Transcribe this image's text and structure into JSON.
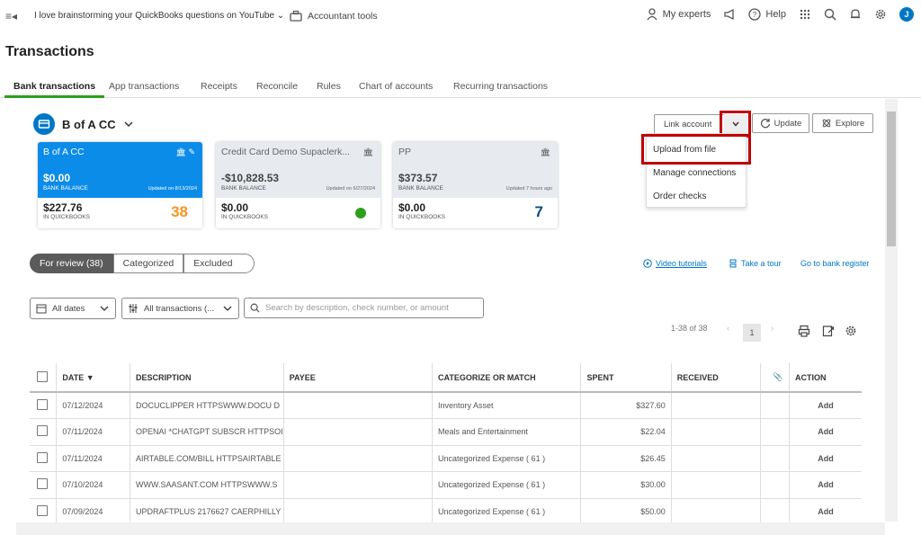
{
  "topbar": {
    "company": "I love brainstorming your QuickBooks questions on YouTube",
    "accountant_tools": "Accountant tools",
    "my_experts": "My experts",
    "help": "Help",
    "avatar_letter": "J"
  },
  "page_title": "Transactions",
  "tabs": [
    {
      "label": "Bank transactions"
    },
    {
      "label": "App transactions"
    },
    {
      "label": "Receipts"
    },
    {
      "label": "Reconcile"
    },
    {
      "label": "Rules"
    },
    {
      "label": "Chart of accounts"
    },
    {
      "label": "Recurring transactions"
    }
  ],
  "account": {
    "name": "B of A CC"
  },
  "cards": [
    {
      "name": "B of A CC",
      "bank_balance": "$0.00",
      "bank_label": "BANK BALANCE",
      "updated": "Updated on 8/13/2024",
      "qb_balance": "$227.76",
      "qb_label": "IN QUICKBOOKS",
      "count": "38"
    },
    {
      "name": "Credit Card Demo Supaclerk...",
      "bank_balance": "-$10,828.53",
      "bank_label": "BANK BALANCE",
      "updated": "Updated on 6/27/2024",
      "qb_balance": "$0.00",
      "qb_label": "IN QUICKBOOKS"
    },
    {
      "name": "PP",
      "bank_balance": "$373.57",
      "bank_label": "BANK BALANCE",
      "updated": "Updated 7 hours ago",
      "qb_balance": "$0.00",
      "qb_label": "IN QUICKBOOKS",
      "count": "7"
    }
  ],
  "actions": {
    "link_account": "Link account",
    "update": "Update",
    "explore": "Explore"
  },
  "dropdown": {
    "items": [
      "Upload from file",
      "Manage connections",
      "Order checks"
    ]
  },
  "review_tabs": [
    "For review (38)",
    "Categorized",
    "Excluded"
  ],
  "links": {
    "video": "Video tutorials",
    "tour": "Take a tour",
    "register": "Go to bank register"
  },
  "filters": {
    "dates": "All dates",
    "transactions": "All transactions (...",
    "search_placeholder": "Search by description, check number, or amount"
  },
  "pagination": {
    "range": "1-38 of 38",
    "page": "1"
  },
  "table": {
    "headers": [
      "DATE ▼",
      "DESCRIPTION",
      "PAYEE",
      "CATEGORIZE OR MATCH",
      "SPENT",
      "RECEIVED",
      "ACTION"
    ],
    "rows": [
      {
        "date": "07/12/2024",
        "description": "DOCUCLIPPER HTTPSWWW.DOCU D",
        "payee": "",
        "category": "Inventory Asset",
        "spent": "$327.60",
        "received": "",
        "action": "Add"
      },
      {
        "date": "07/11/2024",
        "description": "OPENAI *CHATGPT SUBSCR HTTPSOI",
        "payee": "",
        "category": "Meals and Entertainment",
        "spent": "$22.04",
        "received": "",
        "action": "Add"
      },
      {
        "date": "07/11/2024",
        "description": "AIRTABLE.COM/BILL HTTPSAIRTABLE",
        "payee": "",
        "category": "Uncategorized Expense ( 61 )",
        "spent": "$26.45",
        "received": "",
        "action": "Add"
      },
      {
        "date": "07/10/2024",
        "description": "WWW.SAASANT.COM HTTPSWWW.S",
        "payee": "",
        "category": "Uncategorized Expense ( 61 )",
        "spent": "$30.00",
        "received": "",
        "action": "Add"
      },
      {
        "date": "07/09/2024",
        "description": "UPDRAFTPLUS 2176627 CAERPHILLY",
        "payee": "",
        "category": "Uncategorized Expense ( 61 )",
        "spent": "$50.00",
        "received": "",
        "action": "Add"
      }
    ]
  },
  "colors": {
    "brand_green": "#2ca01c",
    "link_blue": "#0077c5",
    "highlight_red": "#c00000",
    "card_selected": "#0c8ce9"
  }
}
